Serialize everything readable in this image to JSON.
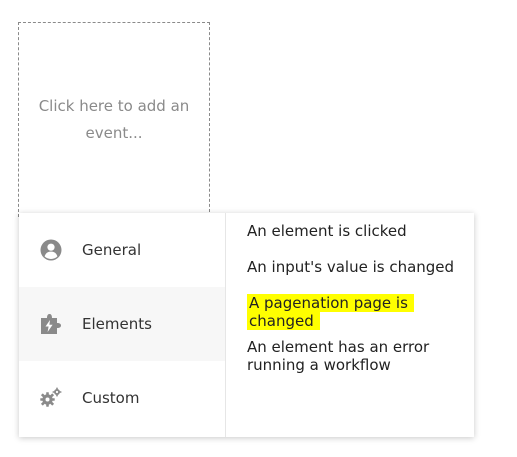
{
  "add_event": {
    "label": "Click here to add an event..."
  },
  "menu": {
    "categories": [
      {
        "label": "General",
        "icon": "user-circle-icon",
        "selected": false
      },
      {
        "label": "Elements",
        "icon": "puzzle-bolt-icon",
        "selected": true
      },
      {
        "label": "Custom",
        "icon": "gears-icon",
        "selected": false
      }
    ],
    "events": [
      {
        "label": "An element is clicked",
        "highlighted": false
      },
      {
        "label": "An input's value is changed",
        "highlighted": false
      },
      {
        "label": "A pagenation page is changed",
        "highlighted": true
      },
      {
        "label": "An element has an error running a workflow",
        "highlighted": false
      }
    ],
    "highlight_color": "#ffff00",
    "selected_bg": "#f7f7f7",
    "icon_color": "#8a8a8a"
  }
}
